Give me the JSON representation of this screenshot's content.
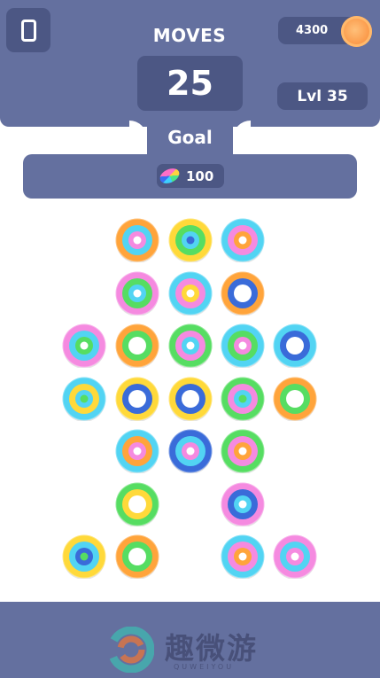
{
  "header": {
    "moves_label": "MOVES",
    "moves_value": "25",
    "coins": "4300",
    "level": "Lvl 35"
  },
  "goal": {
    "label": "Goal",
    "value": "100"
  },
  "watermark": {
    "text": "趣微游",
    "subtext": "QUWEIYOU"
  },
  "colors": {
    "panel": "#64709f",
    "panel_dark": "#4c5784",
    "coin": "#fb9d4e",
    "ring_colors": {
      "P": "#f58ae0",
      "Y": "#ffd93a",
      "G": "#56dd62",
      "O": "#ffa43b",
      "C": "#52d4f3",
      "B": "#3a6bd9",
      "W": "#ffffff"
    }
  },
  "icons": {
    "menu": "phone-icon",
    "coin": "coin-icon",
    "goal": "rainbow-ring-icon"
  },
  "board": {
    "rows": [
      [
        null,
        null,
        "OCPW",
        "YGCB",
        "CPOW",
        null,
        null
      ],
      [
        null,
        null,
        "PGCW",
        "CPYW",
        "OBW",
        null,
        null
      ],
      [
        null,
        "PCGW",
        "OGW",
        "GPCW",
        "CGPW",
        "CBW",
        null
      ],
      [
        null,
        "CYCG",
        "YBW",
        "YBW",
        "GPCG",
        "OGW",
        null
      ],
      [
        null,
        null,
        "COPW",
        "BCPW",
        "GPOW",
        null,
        null
      ],
      [
        null,
        null,
        "GYW",
        null,
        "PBCW",
        null,
        null
      ],
      [
        null,
        "YCBG",
        "OGW",
        null,
        "CPOW",
        "PCPW",
        null
      ]
    ]
  }
}
